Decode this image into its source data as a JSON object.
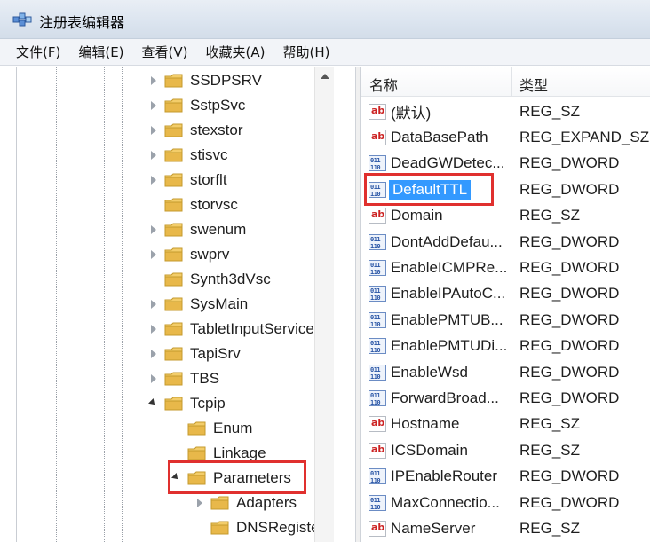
{
  "window": {
    "title": "注册表编辑器"
  },
  "menu": [
    "文件(F)",
    "编辑(E)",
    "查看(V)",
    "收藏夹(A)",
    "帮助(H)"
  ],
  "tree": [
    {
      "label": "SSDPSRV",
      "expander": "collapsed",
      "level": 0
    },
    {
      "label": "SstpSvc",
      "expander": "collapsed",
      "level": 0
    },
    {
      "label": "stexstor",
      "expander": "collapsed",
      "level": 0
    },
    {
      "label": "stisvc",
      "expander": "collapsed",
      "level": 0
    },
    {
      "label": "storflt",
      "expander": "collapsed",
      "level": 0
    },
    {
      "label": "storvsc",
      "expander": "none",
      "level": 0
    },
    {
      "label": "swenum",
      "expander": "collapsed",
      "level": 0
    },
    {
      "label": "swprv",
      "expander": "collapsed",
      "level": 0
    },
    {
      "label": "Synth3dVsc",
      "expander": "none",
      "level": 0
    },
    {
      "label": "SysMain",
      "expander": "collapsed",
      "level": 0
    },
    {
      "label": "TabletInputService",
      "expander": "collapsed",
      "level": 0
    },
    {
      "label": "TapiSrv",
      "expander": "collapsed",
      "level": 0
    },
    {
      "label": "TBS",
      "expander": "collapsed",
      "level": 0
    },
    {
      "label": "Tcpip",
      "expander": "expanded",
      "level": 0
    },
    {
      "label": "Enum",
      "expander": "none",
      "level": 1
    },
    {
      "label": "Linkage",
      "expander": "none",
      "level": 1
    },
    {
      "label": "Parameters",
      "expander": "expanded",
      "level": 1,
      "highlighted": true
    },
    {
      "label": "Adapters",
      "expander": "collapsed",
      "level": 2
    },
    {
      "label": "DNSRegistere",
      "expander": "none",
      "level": 2
    }
  ],
  "list": {
    "columns": {
      "name": "名称",
      "type": "类型"
    },
    "rows": [
      {
        "name": "(默认)",
        "type": "REG_SZ",
        "icon": "string-value-icon"
      },
      {
        "name": "DataBasePath",
        "type": "REG_EXPAND_SZ",
        "icon": "string-value-icon"
      },
      {
        "name": "DeadGWDetec...",
        "type": "REG_DWORD",
        "icon": "dword-value-icon"
      },
      {
        "name": "DefaultTTL",
        "type": "REG_DWORD",
        "icon": "dword-value-icon",
        "selected": true
      },
      {
        "name": "Domain",
        "type": "REG_SZ",
        "icon": "string-value-icon"
      },
      {
        "name": "DontAddDefau...",
        "type": "REG_DWORD",
        "icon": "dword-value-icon"
      },
      {
        "name": "EnableICMPRe...",
        "type": "REG_DWORD",
        "icon": "dword-value-icon"
      },
      {
        "name": "EnableIPAutoC...",
        "type": "REG_DWORD",
        "icon": "dword-value-icon"
      },
      {
        "name": "EnablePMTUB...",
        "type": "REG_DWORD",
        "icon": "dword-value-icon"
      },
      {
        "name": "EnablePMTUDi...",
        "type": "REG_DWORD",
        "icon": "dword-value-icon"
      },
      {
        "name": "EnableWsd",
        "type": "REG_DWORD",
        "icon": "dword-value-icon"
      },
      {
        "name": "ForwardBroad...",
        "type": "REG_DWORD",
        "icon": "dword-value-icon"
      },
      {
        "name": "Hostname",
        "type": "REG_SZ",
        "icon": "string-value-icon"
      },
      {
        "name": "ICSDomain",
        "type": "REG_SZ",
        "icon": "string-value-icon"
      },
      {
        "name": "IPEnableRouter",
        "type": "REG_DWORD",
        "icon": "dword-value-icon"
      },
      {
        "name": "MaxConnectio...",
        "type": "REG_DWORD",
        "icon": "dword-value-icon"
      },
      {
        "name": "NameServer",
        "type": "REG_SZ",
        "icon": "string-value-icon"
      }
    ]
  },
  "colors": {
    "highlight_border": "#e0302e",
    "selection": "#3399ff",
    "folder": "#e8b84a"
  }
}
